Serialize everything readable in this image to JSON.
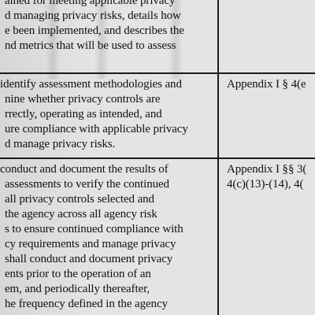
{
  "rows": [
    {
      "left_lines": [
        "ained for meeting applicable privacy",
        "d managing privacy risks, details how",
        "e been implemented, and describes the",
        "nd metrics that will be used to assess"
      ],
      "right_lines": []
    },
    {
      "left_lines": [
        " identify assessment methodologies and",
        "nine whether privacy controls are",
        "rrectly, operating as intended, and",
        "ure compliance with applicable privacy",
        "d manage privacy risks."
      ],
      "right_lines": [
        "Appendix I § 4(e"
      ]
    },
    {
      "left_lines": [
        " conduct and document the results of",
        "assessments to verify the continued",
        "all privacy controls selected and",
        "the agency across all agency risk",
        "s to ensure continued compliance with",
        "cy requirements and manage privacy",
        "shall conduct and document privacy",
        "ents prior to the operation of an",
        "em, and periodically thereafter,",
        "he frequency defined in the agency"
      ],
      "right_lines": [
        "Appendix I §§ 3(",
        "4(c)(13)-(14), 4("
      ]
    }
  ]
}
